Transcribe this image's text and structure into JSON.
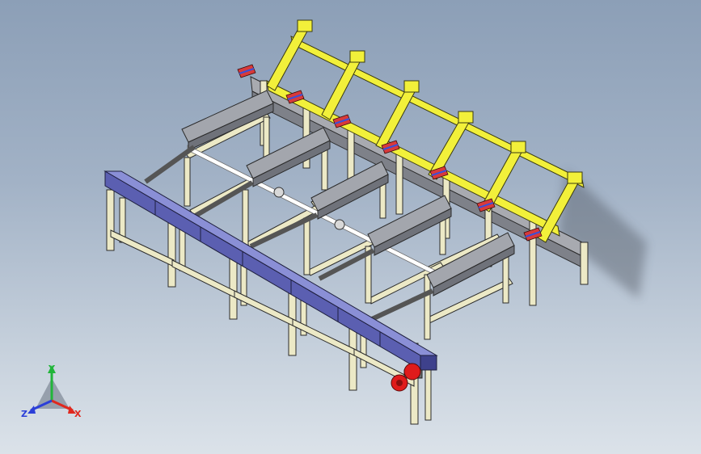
{
  "viewport": {
    "background_top": "#8c9fb7",
    "background_bottom": "#dbe2e9"
  },
  "model": {
    "frame_color": "#ece9c6",
    "frame_edge": "#2b2b2b",
    "conveyor_color": "#5b5fb1",
    "gantry_color": "#f2f03a",
    "guide_color": "#8b8f98",
    "shaft_color": "#ffffff",
    "pad_color": "#d83a3a",
    "pad_accent": "#3a4fd8",
    "motor_color": "#e01b1b",
    "motor_shaft_color": "#6b6b6b"
  },
  "triad": {
    "x_label": "X",
    "y_label": "Y",
    "z_label": "Z",
    "x_color": "#e0281e",
    "y_color": "#21b53a",
    "z_color": "#2b3fd8"
  }
}
